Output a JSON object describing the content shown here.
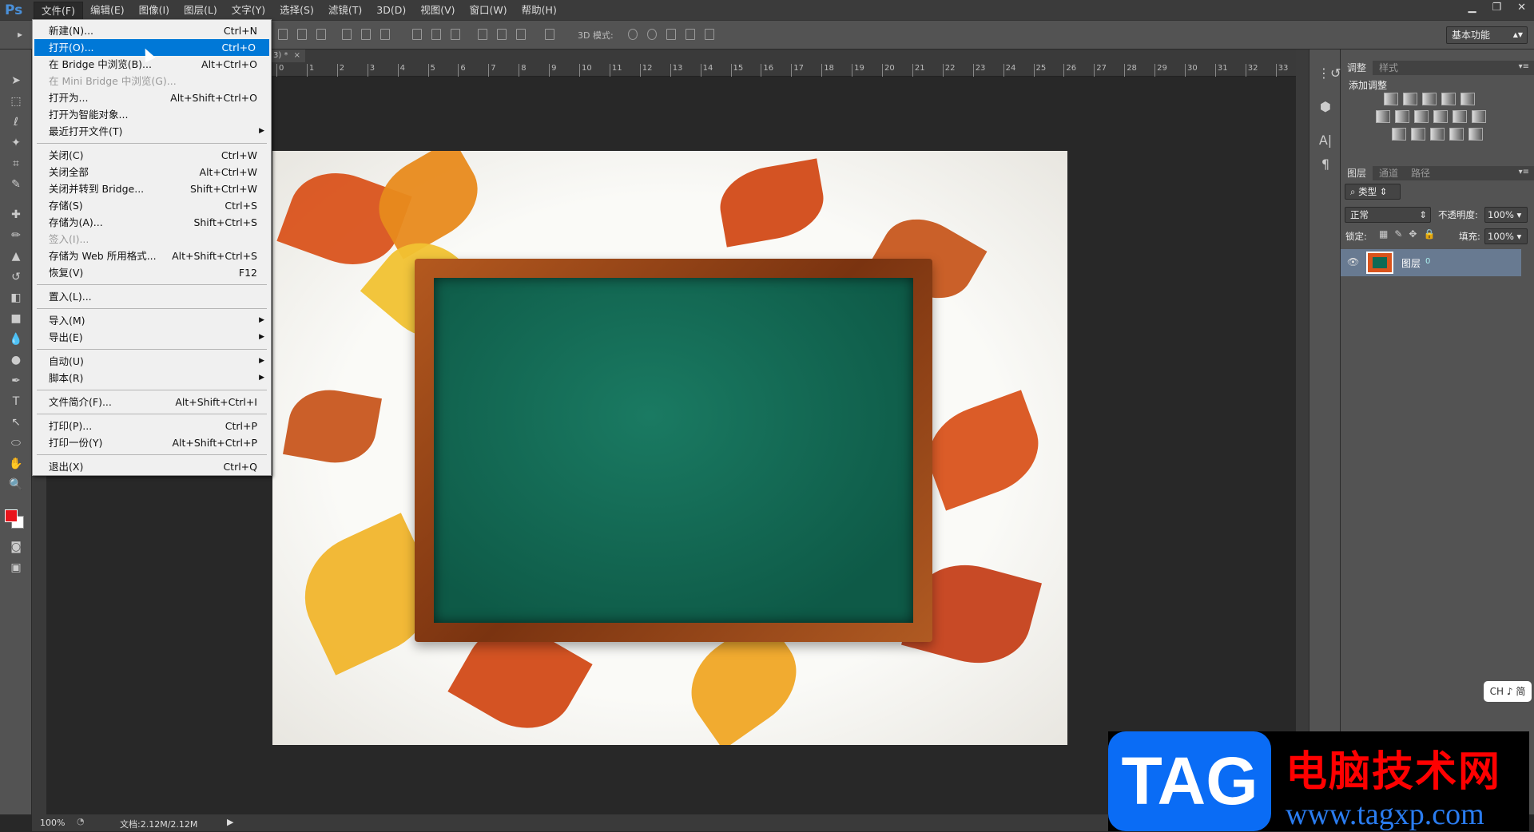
{
  "app": {
    "logo": "Ps"
  },
  "menubar": {
    "items": [
      "文件(F)",
      "编辑(E)",
      "图像(I)",
      "图层(L)",
      "文字(Y)",
      "选择(S)",
      "滤镜(T)",
      "3D(D)",
      "视图(V)",
      "窗口(W)",
      "帮助(H)"
    ]
  },
  "window_controls": {
    "minimize": "▁",
    "restore": "❐",
    "close": "✕"
  },
  "options_bar": {
    "mode_3d_label": "3D 模式:",
    "workspace": "基本功能"
  },
  "document_tab": {
    "title": "3) *",
    "close": "×"
  },
  "ruler": {
    "h_ticks": [
      "0",
      "1",
      "2",
      "3",
      "4",
      "5",
      "6",
      "7",
      "8",
      "9",
      "10",
      "11",
      "12",
      "13",
      "14",
      "15",
      "16",
      "17",
      "18",
      "19",
      "20",
      "21",
      "22",
      "23",
      "24",
      "25",
      "26",
      "27",
      "28",
      "29",
      "30",
      "31",
      "32",
      "33"
    ]
  },
  "file_menu": {
    "groups": [
      [
        {
          "label": "新建(N)...",
          "shortcut": "Ctrl+N"
        },
        {
          "label": "打开(O)...",
          "shortcut": "Ctrl+O",
          "highlighted": true
        },
        {
          "label": "在 Bridge 中浏览(B)...",
          "shortcut": "Alt+Ctrl+O"
        },
        {
          "label": "在 Mini Bridge 中浏览(G)...",
          "shortcut": "",
          "disabled": true
        },
        {
          "label": "打开为...",
          "shortcut": "Alt+Shift+Ctrl+O"
        },
        {
          "label": "打开为智能对象...",
          "shortcut": ""
        },
        {
          "label": "最近打开文件(T)",
          "shortcut": "",
          "submenu": true
        }
      ],
      [
        {
          "label": "关闭(C)",
          "shortcut": "Ctrl+W"
        },
        {
          "label": "关闭全部",
          "shortcut": "Alt+Ctrl+W"
        },
        {
          "label": "关闭并转到 Bridge...",
          "shortcut": "Shift+Ctrl+W"
        },
        {
          "label": "存储(S)",
          "shortcut": "Ctrl+S"
        },
        {
          "label": "存储为(A)...",
          "shortcut": "Shift+Ctrl+S"
        },
        {
          "label": "签入(I)...",
          "shortcut": "",
          "disabled": true
        },
        {
          "label": "存储为 Web 所用格式...",
          "shortcut": "Alt+Shift+Ctrl+S"
        },
        {
          "label": "恢复(V)",
          "shortcut": "F12"
        }
      ],
      [
        {
          "label": "置入(L)...",
          "shortcut": ""
        }
      ],
      [
        {
          "label": "导入(M)",
          "shortcut": "",
          "submenu": true
        },
        {
          "label": "导出(E)",
          "shortcut": "",
          "submenu": true
        }
      ],
      [
        {
          "label": "自动(U)",
          "shortcut": "",
          "submenu": true
        },
        {
          "label": "脚本(R)",
          "shortcut": "",
          "submenu": true
        }
      ],
      [
        {
          "label": "文件简介(F)...",
          "shortcut": "Alt+Shift+Ctrl+I"
        }
      ],
      [
        {
          "label": "打印(P)...",
          "shortcut": "Ctrl+P"
        },
        {
          "label": "打印一份(Y)",
          "shortcut": "Alt+Shift+Ctrl+P"
        }
      ],
      [
        {
          "label": "退出(X)",
          "shortcut": "Ctrl+Q"
        }
      ]
    ]
  },
  "adjustments_panel": {
    "tabs": [
      "调整",
      "样式"
    ],
    "title": "添加调整"
  },
  "layers_panel": {
    "tabs": [
      "图层",
      "通道",
      "路径"
    ],
    "filter": "类型",
    "blend_mode": "正常",
    "opacity_label": "不透明度:",
    "opacity": "100%",
    "lock_label": "锁定:",
    "fill_label": "填充:",
    "fill": "100%",
    "layers": [
      {
        "name": "图层",
        "index": "0",
        "visible": true
      }
    ]
  },
  "status_bar": {
    "zoom": "100%",
    "doc_info": "文档:2.12M/2.12M"
  },
  "ime": {
    "label": "CH ♪ 简"
  },
  "watermark": {
    "tag": "TAG",
    "cn": "电脑技术网",
    "url": "www.tagxp.com"
  },
  "colors": {
    "accent": "#0078d7",
    "foreground": "#e8141b",
    "background": "#ffffff"
  }
}
